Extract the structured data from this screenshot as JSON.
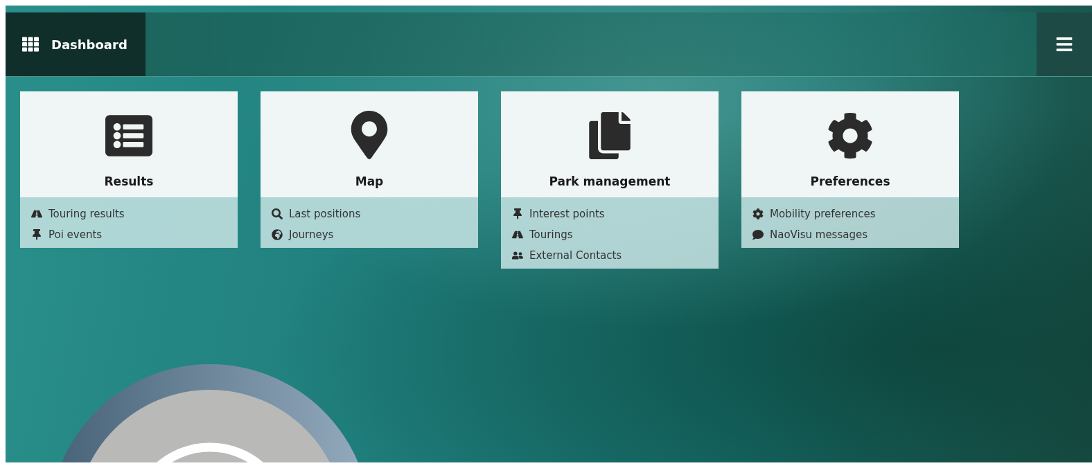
{
  "header": {
    "title": "Dashboard"
  },
  "cards": [
    {
      "title": "Results",
      "items": [
        "Touring results",
        "Poi events"
      ]
    },
    {
      "title": "Map",
      "items": [
        "Last positions",
        "Journeys"
      ]
    },
    {
      "title": "Park management",
      "items": [
        "Interest points",
        "Tourings",
        "External Contacts"
      ]
    },
    {
      "title": "Preferences",
      "items": [
        "Mobility preferences",
        "NaoVisu messages"
      ]
    }
  ]
}
